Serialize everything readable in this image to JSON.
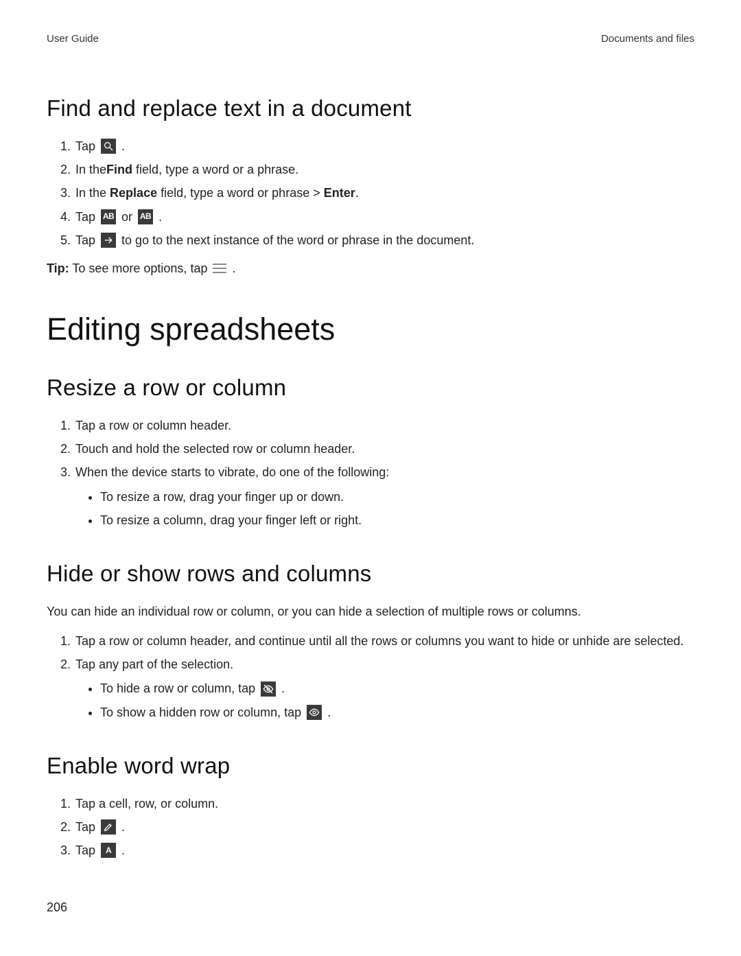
{
  "header": {
    "left": "User Guide",
    "right": "Documents and files"
  },
  "section_find_replace": {
    "heading": "Find and replace text in a document",
    "steps": {
      "s1_a": "Tap ",
      "s1_b": " .",
      "s2_a": "In the",
      "s2_b": "Find",
      "s2_c": " field, type a word or a phrase.",
      "s3_a": "In the ",
      "s3_b": "Replace",
      "s3_c": " field, type a word or phrase > ",
      "s3_d": "Enter",
      "s3_e": ".",
      "s4_a": "Tap ",
      "s4_b": " or ",
      "s4_c": " .",
      "s5_a": "Tap ",
      "s5_b": " to go to the next instance of the word or phrase in the document."
    },
    "tip_label": "Tip:",
    "tip_text": " To see more options, tap ",
    "tip_end": " ."
  },
  "section_spreadsheets": {
    "heading": "Editing spreadsheets"
  },
  "section_resize": {
    "heading": "Resize a row or column",
    "steps": {
      "s1": "Tap a row or column header.",
      "s2": "Touch and hold the selected row or column header.",
      "s3": "When the device starts to vibrate, do one of the following:"
    },
    "bullets": {
      "b1": "To resize a row, drag your finger up or down.",
      "b2": "To resize a column, drag your finger left or right."
    }
  },
  "section_hide": {
    "heading": "Hide or show rows and columns",
    "intro": "You can hide an individual row or column, or you can hide a selection of multiple rows or columns.",
    "steps": {
      "s1": "Tap a row or column header, and continue until all the rows or columns you want to hide or unhide are selected.",
      "s2": "Tap any part of the selection."
    },
    "bullets": {
      "b1_a": "To hide a row or column, tap ",
      "b1_b": " .",
      "b2_a": "To show a hidden row or column, tap ",
      "b2_b": " ."
    }
  },
  "section_wrap": {
    "heading": "Enable word wrap",
    "steps": {
      "s1": "Tap a cell, row, or column.",
      "s2_a": "Tap ",
      "s2_b": ".",
      "s3_a": "Tap ",
      "s3_b": " ."
    }
  },
  "page_number": "206",
  "icon_labels": {
    "replace_single": "AB",
    "replace_all": "AB",
    "text_format": "A"
  }
}
